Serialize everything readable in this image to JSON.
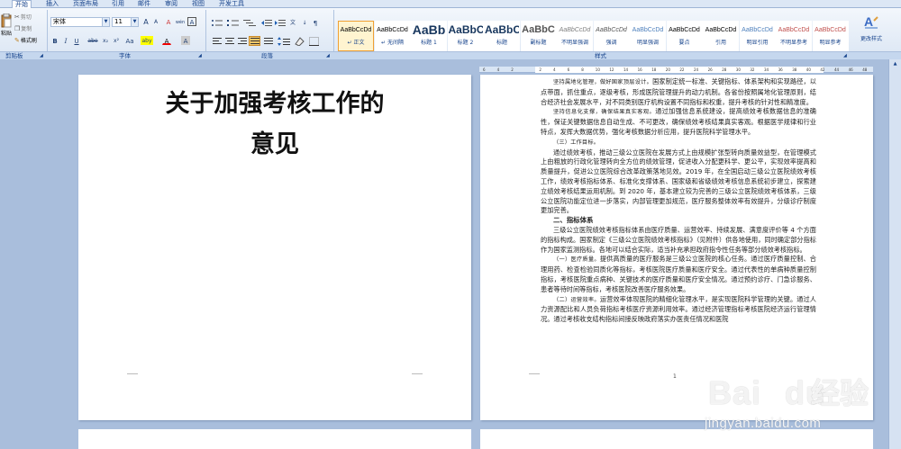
{
  "tabs": [
    "开始",
    "插入",
    "页面布局",
    "引用",
    "邮件",
    "审阅",
    "视图",
    "开发工具"
  ],
  "clipboard": {
    "paste": "粘贴",
    "cut": "剪切",
    "copy": "复制",
    "format_painter": "格式刷",
    "group": "剪贴板"
  },
  "font": {
    "name": "宋体",
    "size": "11",
    "group": "字体",
    "grow": "A",
    "shrink": "A",
    "clear": "A",
    "phonetic": "wén",
    "bold": "B",
    "italic": "I",
    "underline": "U",
    "strike": "abe",
    "sub": "x₂",
    "sup": "x²",
    "case": "Aa",
    "highlight": "aby",
    "color": "A",
    "border_char": "A",
    "shade": "A"
  },
  "paragraph": {
    "group": "段落"
  },
  "styles": {
    "group": "样式",
    "items": [
      {
        "sample": "AaBbCcDd",
        "name": "↵ 正文",
        "size": "7px"
      },
      {
        "sample": "AaBbCcDd",
        "name": "↵ 无间隔",
        "size": "7px"
      },
      {
        "sample": "AaBb",
        "name": "标题 1",
        "size": "14px"
      },
      {
        "sample": "AaBbC",
        "name": "标题 2",
        "size": "12px"
      },
      {
        "sample": "AaBbC",
        "name": "标题",
        "size": "12px"
      },
      {
        "sample": "AaBbC",
        "name": "副标题",
        "size": "11px"
      },
      {
        "sample": "AaBbCcDd",
        "name": "不明显强调",
        "size": "7px"
      },
      {
        "sample": "AaBbCcDd",
        "name": "强调",
        "size": "7px"
      },
      {
        "sample": "AaBbCcDd",
        "name": "明显强调",
        "size": "7px"
      },
      {
        "sample": "AaBbCcDd",
        "name": "要点",
        "size": "7px"
      },
      {
        "sample": "AaBbCcDd",
        "name": "引用",
        "size": "7px"
      },
      {
        "sample": "AaBbCcDd",
        "name": "明显引用",
        "size": "7px"
      },
      {
        "sample": "AaBbCcDd",
        "name": "不明显参考",
        "size": "7px"
      },
      {
        "sample": "AaBbCcDd",
        "name": "明显参考",
        "size": "7px"
      }
    ],
    "change": "更改样式"
  },
  "ruler_ticks": [
    "6",
    "4",
    "2",
    "",
    "2",
    "4",
    "6",
    "8",
    "10",
    "12",
    "14",
    "16",
    "18",
    "20",
    "22",
    "24",
    "26",
    "28",
    "30",
    "32",
    "34",
    "36",
    "38",
    "40",
    "42",
    "44",
    "46",
    "48"
  ],
  "page1": {
    "title_line1": "关于加强考核工作的",
    "title_line2": "意见"
  },
  "page2": {
    "p1_em": "坚持属地化管理，做好国家顶层设计。",
    "p1": "国家制定统一标准、关键指标、体系架构和实现路径，以点带面，抓住重点，逐级考核，形成医院管理提升的动力机制。各省份按照属地化管理原则，结合经济社会发展水平，对不同类别医疗机构设置不同指标和权重，提升考核的针对性和精准度。",
    "p2_em": "坚持信息化支撑，确保结果真实客观。",
    "p2": "通过加强信息系统建设，提高绩效考核数据信息的准确性，保证关键数据信息自动生成、不可更改，确保绩效考核结果真实客观。根据医学规律和行业特点，发挥大数据优势，强化考核数据分析应用，提升医院科学管理水平。",
    "p3_em": "（三）工作目标。",
    "p4": "通过绩效考核，推动三级公立医院在发展方式上由规模扩张型转向质量效益型，在管理模式上由粗放的行政化管理转向全方位的绩效管理，促进收入分配更科学、更公平，实现效率提高和质量提升，促进公立医院综合改革政策落地见效。2019 年，在全国启动三级公立医院绩效考核工作，绩效考核指标体系、标准化支撑体系、国家级和省级绩效考核信息系统初步建立，探索建立绩效考核结果运用机制。到 2020 年，基本建立较为完善的三级公立医院绩效考核体系，三级公立医院功能定位进一步落实，内部管理更加规范，医疗服务整体效率有效提升，分级诊疗制度更加完善。",
    "h2": "二、指标体系",
    "p5": "三级公立医院绩效考核指标体系由医疗质量、运营效率、持续发展、满意度评价等 4 个方面的指标构成。国家制定《三级公立医院绩效考核指标》（见附件）供各地使用，同时确定部分指标作为国家监测指标。各地可以结合实际，适当补充承担政府指令性任务等部分绩效考核指标。",
    "p6_em": "（一）医疗质量。",
    "p6": "提供高质量的医疗服务是三级公立医院的核心任务。通过医疗质量控制、合理用药、检查检验同质化等指标，考核医院医疗质量和医疗安全。通过代表性的单病种质量控制指标，考核医院重点病种、关键技术的医疗质量和医疗安全情况。通过预约诊疗、门急诊服务、患者等待时间等指标，考核医院改善医疗服务效果。",
    "p7_em": "（二）运营效率。",
    "p7": "运营效率体现医院的精细化管理水平，是实现医院科学管理的关键。通过人力资源配比和人员负荷指标考核医疗资源利用效率。通过经济管理指标考核医院经济运行管理情况。通过考核收支结构指标间接反映政府落实办医责任情况和医院",
    "page_number": "1"
  },
  "watermark": {
    "brand": "Bai",
    "brand2": "du",
    "cn": "经验",
    "url": "jingyan.baidu.com"
  }
}
